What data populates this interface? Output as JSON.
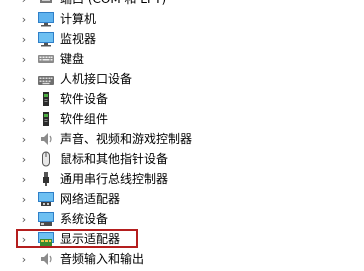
{
  "device_tree": {
    "items": [
      {
        "label": "端口 (COM 和 LPT)",
        "icon": "port-icon"
      },
      {
        "label": "计算机",
        "icon": "computer-icon"
      },
      {
        "label": "监视器",
        "icon": "monitor-icon"
      },
      {
        "label": "键盘",
        "icon": "keyboard-icon"
      },
      {
        "label": "人机接口设备",
        "icon": "hid-icon"
      },
      {
        "label": "软件设备",
        "icon": "software-device-icon"
      },
      {
        "label": "软件组件",
        "icon": "software-component-icon"
      },
      {
        "label": "声音、视频和游戏控制器",
        "icon": "sound-icon"
      },
      {
        "label": "鼠标和其他指针设备",
        "icon": "mouse-icon"
      },
      {
        "label": "通用串行总线控制器",
        "icon": "usb-icon"
      },
      {
        "label": "网络适配器",
        "icon": "network-adapter-icon"
      },
      {
        "label": "系统设备",
        "icon": "system-device-icon"
      },
      {
        "label": "显示适配器",
        "icon": "display-adapter-icon"
      },
      {
        "label": "音频输入和输出",
        "icon": "audio-io-icon"
      }
    ],
    "expand_glyph": "›",
    "highlighted_item_index": 12
  },
  "colors": {
    "highlight_border": "#b41e1e",
    "icon_blue": "#3b8fd6",
    "icon_dark": "#333333"
  }
}
